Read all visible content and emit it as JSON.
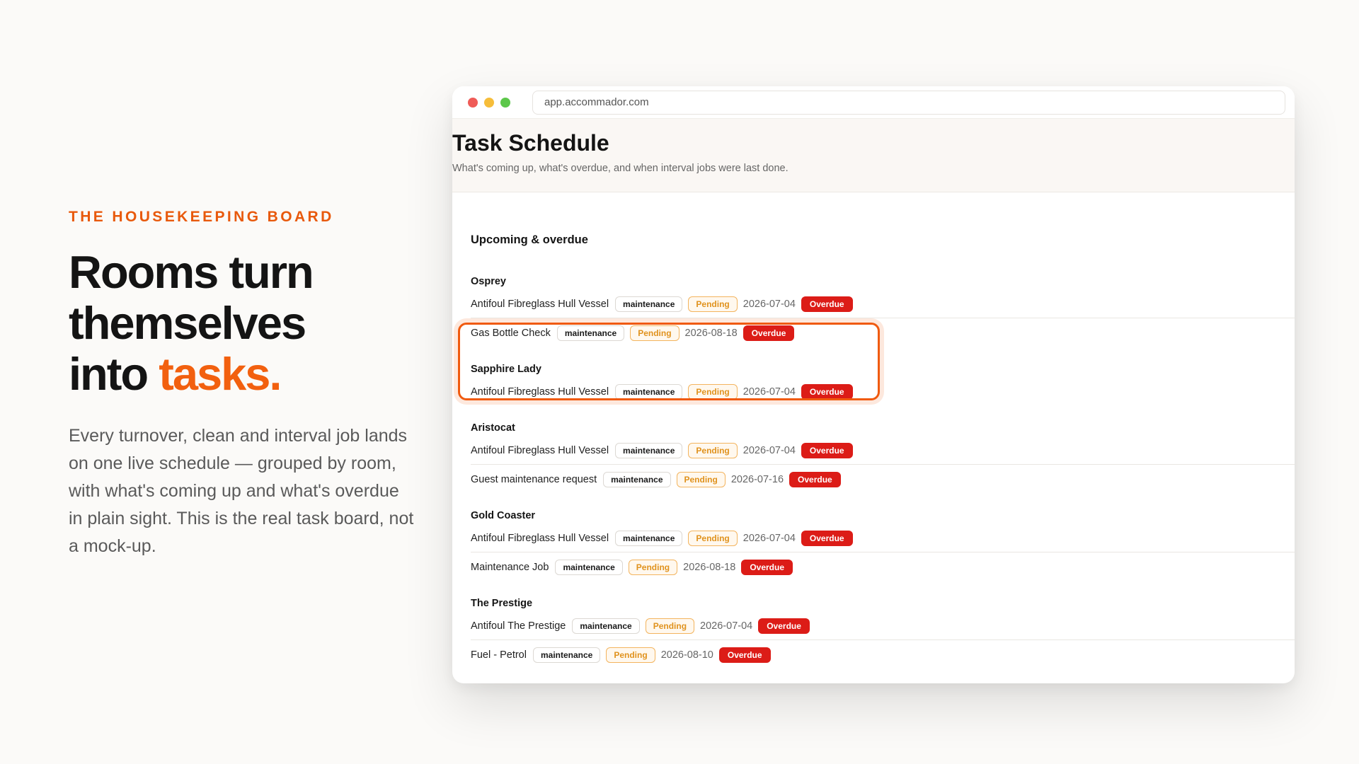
{
  "hero": {
    "eyebrow": "THE HOUSEKEEPING BOARD",
    "headline_line1": "Rooms turn",
    "headline_line2": "themselves",
    "headline_line3_prefix": "into ",
    "headline_accent": "tasks.",
    "lede": "Every turnover, clean and interval job lands on one live schedule — grouped by room, with what's coming up and what's overdue in plain sight. This is the real task board, not a mock-up."
  },
  "browser": {
    "url": "app.accommador.com"
  },
  "page": {
    "title": "Task Schedule",
    "subtitle": "What's coming up, what's overdue, and when interval jobs were last done.",
    "section_title": "Upcoming & overdue"
  },
  "rooms": [
    {
      "name": "Osprey",
      "highlighted": true,
      "tasks": [
        {
          "name": "Antifoul Fibreglass Hull Vessel",
          "category": "maintenance",
          "status": "Pending",
          "due": "2026-07-04",
          "flag": "Overdue"
        },
        {
          "name": "Gas Bottle Check",
          "category": "maintenance",
          "status": "Pending",
          "due": "2026-08-18",
          "flag": "Overdue"
        }
      ]
    },
    {
      "name": "Sapphire Lady",
      "tasks": [
        {
          "name": "Antifoul Fibreglass Hull Vessel",
          "category": "maintenance",
          "status": "Pending",
          "due": "2026-07-04",
          "flag": "Overdue"
        }
      ]
    },
    {
      "name": "Aristocat",
      "tasks": [
        {
          "name": "Antifoul Fibreglass Hull Vessel",
          "category": "maintenance",
          "status": "Pending",
          "due": "2026-07-04",
          "flag": "Overdue"
        },
        {
          "name": "Guest maintenance request",
          "category": "maintenance",
          "status": "Pending",
          "due": "2026-07-16",
          "flag": "Overdue"
        }
      ]
    },
    {
      "name": "Gold Coaster",
      "tasks": [
        {
          "name": "Antifoul Fibreglass Hull Vessel",
          "category": "maintenance",
          "status": "Pending",
          "due": "2026-07-04",
          "flag": "Overdue"
        },
        {
          "name": "Maintenance Job",
          "category": "maintenance",
          "status": "Pending",
          "due": "2026-08-18",
          "flag": "Overdue"
        }
      ]
    },
    {
      "name": "The Prestige",
      "tasks": [
        {
          "name": "Antifoul The Prestige",
          "category": "maintenance",
          "status": "Pending",
          "due": "2026-07-04",
          "flag": "Overdue"
        },
        {
          "name": "Fuel - Petrol",
          "category": "maintenance",
          "status": "Pending",
          "due": "2026-08-10",
          "flag": "Overdue"
        }
      ]
    }
  ],
  "colors": {
    "accent": "#f2600f",
    "overdue": "#dc1c17",
    "pending": "#e0921d"
  }
}
